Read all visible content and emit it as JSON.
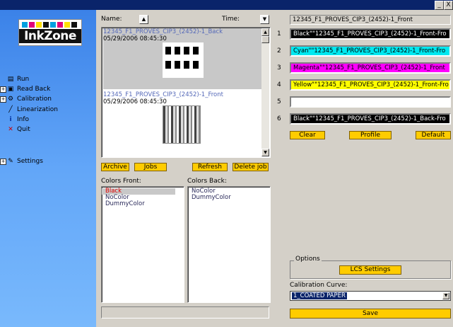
{
  "window": {
    "controls": [
      "_",
      "X"
    ]
  },
  "sidebar": {
    "logo_text": "InkZone",
    "logo_swatches": [
      "#00a0e0",
      "#e0007a",
      "#ffe000",
      "#111111",
      "#00a0e0",
      "#e0007a",
      "#ffe000",
      "#111111"
    ],
    "items": [
      {
        "label": "Run",
        "icon": "run-icon",
        "expandable": false
      },
      {
        "label": "Read Back",
        "icon": "readback-icon",
        "expandable": true
      },
      {
        "label": "Calibration",
        "icon": "calibration-icon",
        "expandable": true
      },
      {
        "label": "Linearization",
        "icon": "linearization-icon",
        "expandable": false
      },
      {
        "label": "Info",
        "icon": "info-icon",
        "expandable": false
      },
      {
        "label": "Quit",
        "icon": "quit-icon",
        "expandable": false
      }
    ],
    "settings": {
      "label": "Settings",
      "icon": "settings-icon"
    }
  },
  "jobs": {
    "name_header": "Name:",
    "time_header": "Time:",
    "items": [
      {
        "name": "12345_F1_PROVES_CIP3_(2452)-1_Back",
        "date": "05/29/2006 08:45:30",
        "selected": true
      },
      {
        "name": "12345_F1_PROVES_CIP3_(2452)-1_Front",
        "date": "05/29/2006 08:45:30",
        "selected": false
      }
    ],
    "buttons": {
      "archive": "Archive",
      "jobs": "Jobs",
      "refresh": "Refresh",
      "delete": "Delete job"
    }
  },
  "colors_front": {
    "label": "Colors Front:",
    "items": [
      "Black",
      "NoColor",
      "DummyColor"
    ]
  },
  "colors_back": {
    "label": "Colors Back:",
    "items": [
      "NoColor",
      "DummyColor"
    ]
  },
  "right": {
    "job_title": "12345_F1_PROVES_CIP3_(2452)-1_Front",
    "fields": [
      {
        "num": "1",
        "text": "Black\"\"12345_F1_PROVES_CIP3_(2452)-1_Front-Fro",
        "bg": "#000000",
        "fg": "#ffffff"
      },
      {
        "num": "2",
        "text": "Cyan\"\"12345_F1_PROVES_CIP3_(2452)-1_Front-Fro",
        "bg": "#00e8f0",
        "fg": "#000000"
      },
      {
        "num": "3",
        "text": "Magenta\"\"12345_F1_PROVES_CIP3_(2452)-1_Front",
        "bg": "#ff00ff",
        "fg": "#000000"
      },
      {
        "num": "4",
        "text": "Yellow\"\"12345_F1_PROVES_CIP3_(2452)-1_Front-Fro",
        "bg": "#ffff00",
        "fg": "#000000"
      },
      {
        "num": "5",
        "text": "",
        "bg": "#ffffff",
        "fg": "#000000"
      },
      {
        "num": "6",
        "text": "Black\"\"12345_F1_PROVES_CIP3_(2452)-1_Back-Fro",
        "bg": "#000000",
        "fg": "#ffffff"
      }
    ],
    "buttons": {
      "clear": "Clear",
      "profile": "Profile",
      "default": "Default"
    },
    "options_label": "Options",
    "lcs_settings": "LCS Settings",
    "calibration_curve_label": "Calibration Curve:",
    "calibration_curve_value": "1_COATED PAPER",
    "save": "Save"
  }
}
